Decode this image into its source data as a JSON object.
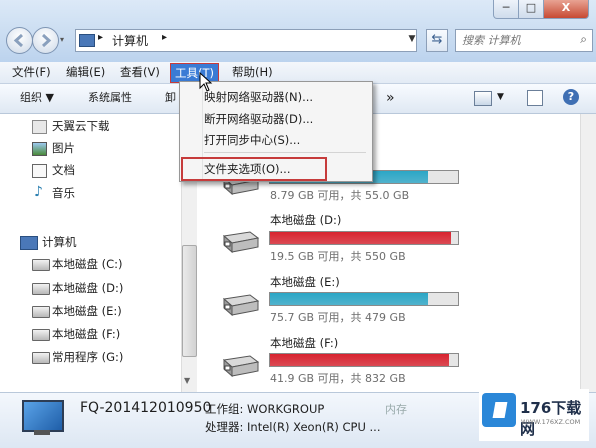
{
  "window": {
    "min_label": "─",
    "max_label": "□",
    "close_label": "X"
  },
  "address": {
    "path_root": "▸",
    "path_item": "计算机",
    "path_sep": "▸",
    "search_placeholder": "搜索 计算机"
  },
  "menubar": [
    "文件(F)",
    "编辑(E)",
    "查看(V)",
    "工具(T)",
    "帮助(H)"
  ],
  "toolbar": {
    "organize": "组织 ▼",
    "properties": "系统属性",
    "truncated": "卸",
    "more": "»"
  },
  "tools_menu": {
    "items": [
      "映射网络驱动器(N)...",
      "断开网络驱动器(D)...",
      "打开同步中心(S)...",
      "文件夹选项(O)..."
    ]
  },
  "nav": {
    "favorites": [
      "天翼云下载",
      "图片",
      "文档",
      "音乐"
    ],
    "computer": "计算机",
    "drives": [
      "本地磁盘 (C:)",
      "本地磁盘 (D:)",
      "本地磁盘 (E:)",
      "本地磁盘 (F:)",
      "常用程序 (G:)"
    ]
  },
  "drives": [
    {
      "label": "",
      "info": "8.79 GB 可用，共 55.0 GB",
      "used_fraction": 0.84,
      "color": "#2ba6c6"
    },
    {
      "label": "本地磁盘 (D:)",
      "info": "19.5 GB 可用，共 550 GB",
      "used_fraction": 0.965,
      "color": "#d8232f"
    },
    {
      "label": "本地磁盘 (E:)",
      "info": "75.7 GB 可用，共 479 GB",
      "used_fraction": 0.84,
      "color": "#2ba6c6"
    },
    {
      "label": "本地磁盘 (F:)",
      "info": "41.9 GB 可用，共 832 GB",
      "used_fraction": 0.95,
      "color": "#d8232f"
    }
  ],
  "details": {
    "name": "FQ-201412010950",
    "workgroup": "工作组: WORKGROUP",
    "processor": "处理器: Intel(R) Xeon(R) CPU ...",
    "memory_partial": "内存"
  },
  "watermark": {
    "text": "176下载网",
    "url": "WWW.176XZ.COM"
  }
}
